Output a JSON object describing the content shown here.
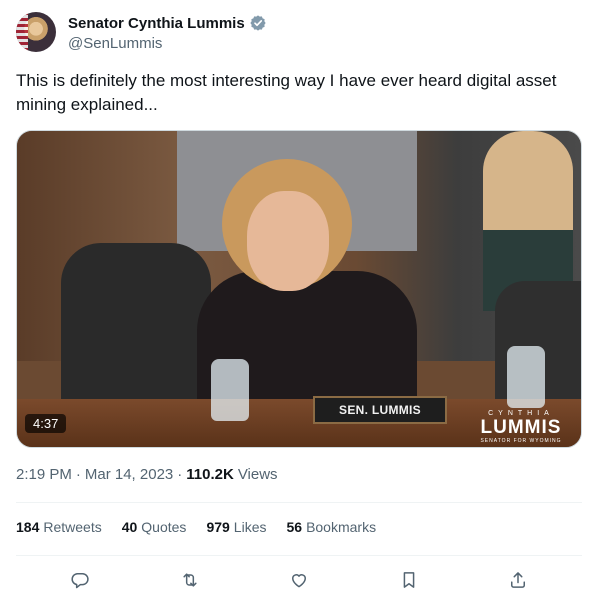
{
  "author": {
    "display_name": "Senator Cynthia Lummis",
    "handle": "@SenLummis",
    "verified_icon": "verified-badge-icon",
    "verified_color": "#829aab"
  },
  "tweet": {
    "text": "This is definitely the most interesting way I have ever heard digital asset mining explained..."
  },
  "media": {
    "type": "video",
    "duration": "4:37",
    "nameplate": "SEN. LUMMIS",
    "logo_top": "CYNTHIA",
    "logo_main": "LUMMIS",
    "logo_sub": "SENATOR FOR WYOMING"
  },
  "meta": {
    "time": "2:19 PM",
    "separator": "·",
    "date": "Mar 14, 2023",
    "views_count": "110.2K",
    "views_label": "Views"
  },
  "stats": [
    {
      "count": "184",
      "label": "Retweets"
    },
    {
      "count": "40",
      "label": "Quotes"
    },
    {
      "count": "979",
      "label": "Likes"
    },
    {
      "count": "56",
      "label": "Bookmarks"
    }
  ],
  "actions": [
    {
      "icon": "reply-icon"
    },
    {
      "icon": "retweet-icon"
    },
    {
      "icon": "like-icon"
    },
    {
      "icon": "bookmark-icon"
    },
    {
      "icon": "share-icon"
    }
  ],
  "colors": {
    "text_primary": "#0f1419",
    "text_secondary": "#536471",
    "divider": "#eff3f4"
  }
}
